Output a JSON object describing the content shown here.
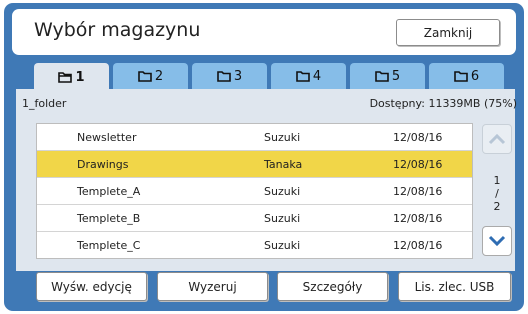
{
  "header": {
    "title": "Wybór magazynu",
    "close_label": "Zamknij"
  },
  "tabs": [
    {
      "label": "1",
      "active": true
    },
    {
      "label": "2",
      "active": false
    },
    {
      "label": "3",
      "active": false
    },
    {
      "label": "4",
      "active": false
    },
    {
      "label": "5",
      "active": false
    },
    {
      "label": "6",
      "active": false
    }
  ],
  "folder": {
    "name": "1_folder",
    "available": "Dostępny: 11339MB (75%)"
  },
  "rows": [
    {
      "name": "Newsletter",
      "owner": "Suzuki",
      "date": "12/08/16",
      "selected": false
    },
    {
      "name": "Drawings",
      "owner": "Tanaka",
      "date": "12/08/16",
      "selected": true
    },
    {
      "name": "Templete_A",
      "owner": "Suzuki",
      "date": "12/08/16",
      "selected": false
    },
    {
      "name": "Templete_B",
      "owner": "Suzuki",
      "date": "12/08/16",
      "selected": false
    },
    {
      "name": "Templete_C",
      "owner": "Suzuki",
      "date": "12/08/16",
      "selected": false
    }
  ],
  "pager": {
    "current": "1",
    "sep": "/",
    "total": "2"
  },
  "buttons": {
    "show_edit": "Wyśw. edycję",
    "reset": "Wyzeruj",
    "details": "Szczegóły",
    "usb_list": "Lis. zlec. USB"
  },
  "colors": {
    "frame": "#3f79b6",
    "tab": "#86bde8",
    "panel": "#dfe6ee",
    "selected_row": "#f1d648",
    "scroll_arrow": "#2f6db3"
  },
  "icons": {
    "tab": "folder-icon",
    "scroll_up": "chevron-up-icon",
    "scroll_down": "chevron-down-icon"
  }
}
